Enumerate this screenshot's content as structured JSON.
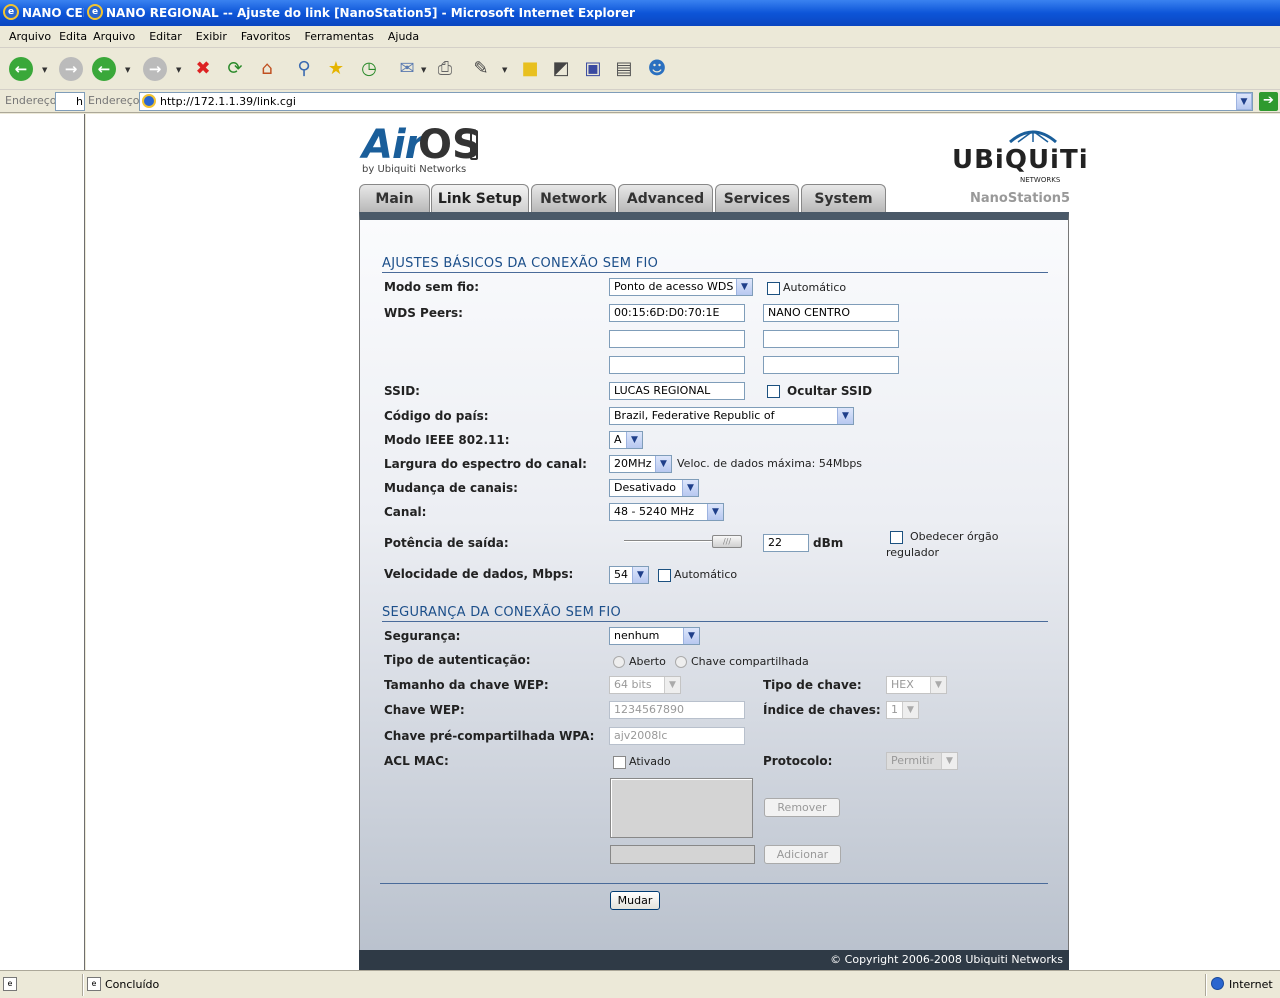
{
  "titlebars": [
    {
      "title": "NANO CENTRO"
    },
    {
      "title": "NANO REGIONAL -- Ajuste do link [NanoStation5] - Microsoft Internet Explorer"
    }
  ],
  "menus": [
    {
      "items": [
        "Arquivo",
        "Editar"
      ]
    },
    {
      "items": [
        "Arquivo",
        "Editar",
        "Exibir",
        "Favoritos",
        "Ferramentas",
        "Ajuda"
      ]
    }
  ],
  "address": {
    "label_left": "Endereço",
    "value_left": "h",
    "label": "Endereço",
    "url": "http://172.1.1.39/link.cgi"
  },
  "header": {
    "logo_air": "Air",
    "logo_os": "OS",
    "logo_sub": "by Ubiquiti Networks",
    "brand": "UBiQUiTi",
    "brand_sub": "NETWORKS",
    "model": "NanoStation5"
  },
  "tabs": [
    "Main",
    "Link Setup",
    "Network",
    "Advanced",
    "Services",
    "System"
  ],
  "active_tab": "Link Setup",
  "basic": {
    "title": "AJUSTES BÁSICOS DA CONEXÃO SEM FIO",
    "mode_label": "Modo sem fio:",
    "mode_value": "Ponto de acesso WDS",
    "auto_label": "Automático",
    "wds_label": "WDS Peers:",
    "wds_peers": [
      "00:15:6D:D0:70:1E",
      "NANO CENTRO",
      "",
      "",
      "",
      ""
    ],
    "ssid_label": "SSID:",
    "ssid_value": "LUCAS REGIONAL",
    "hide_ssid_label": "Ocultar SSID",
    "country_label": "Código do país:",
    "country_value": "Brazil, Federative Republic of",
    "ieee_label": "Modo IEEE 802.11:",
    "ieee_value": "A",
    "width_label": "Largura do espectro do canal:",
    "width_value": "20MHz",
    "max_rate": "Veloc. de dados máxima: 54Mbps",
    "chanshift_label": "Mudança de canais:",
    "chanshift_value": "Desativado",
    "channel_label": "Canal:",
    "channel_value": "48 - 5240 MHz",
    "power_label": "Potência de saída:",
    "power_value": "22",
    "power_unit": "dBm",
    "power_level": 1.0,
    "obey_label_1": "Obedecer órgão",
    "obey_label_2": "regulador",
    "rate_label": "Velocidade de dados, Mbps:",
    "rate_value": "54",
    "rate_auto_label": "Automático"
  },
  "security": {
    "title": "SEGURANÇA DA CONEXÃO SEM FIO",
    "security_label": "Segurança:",
    "security_value": "nenhum",
    "auth_label": "Tipo de autenticação:",
    "auth_open": "Aberto",
    "auth_shared": "Chave compartilhada",
    "wep_size_label": "Tamanho da chave WEP:",
    "wep_size_value": "64 bits",
    "key_type_label": "Tipo de chave:",
    "key_type_value": "HEX",
    "wep_key_label": "Chave WEP:",
    "wep_key_value": "1234567890",
    "key_index_label": "Índice de chaves:",
    "key_index_value": "1",
    "wpa_label": "Chave pré-compartilhada WPA:",
    "wpa_value": "ajv2008lc",
    "acl_label": "ACL MAC:",
    "acl_enabled_label": "Ativado",
    "protocol_label": "Protocolo:",
    "protocol_value": "Permitir",
    "remove_label": "Remover",
    "add_label": "Adicionar"
  },
  "submit_label": "Mudar",
  "copyright": "© Copyright 2006-2008 Ubiquiti Networks",
  "status": {
    "text": "Concluído",
    "zone": "Internet"
  },
  "colors": {
    "title_blue": "#0a3fc8",
    "section_blue": "#1c4f8a",
    "panel_top": "#4a5968",
    "footer_bg": "#2f3a46"
  }
}
